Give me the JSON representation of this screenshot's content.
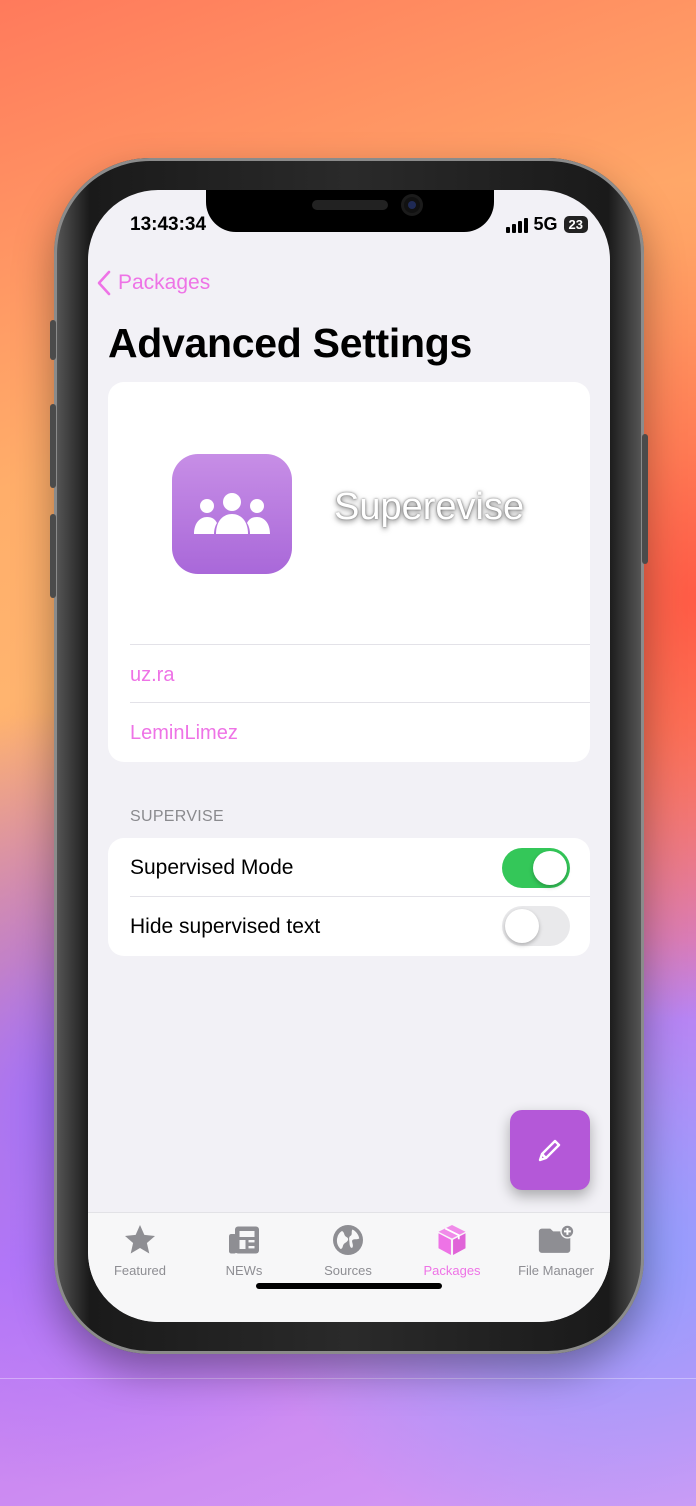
{
  "status_bar": {
    "time": "13:43:34",
    "network": "5G",
    "battery": "23"
  },
  "nav": {
    "back_label": "Packages",
    "title": "Advanced Settings"
  },
  "app_info": {
    "name": "Superevise",
    "links": [
      "uz.ra",
      "LeminLimez"
    ]
  },
  "supervise_section": {
    "header": "SUPERVISE",
    "rows": [
      {
        "label": "Supervised Mode",
        "enabled": true
      },
      {
        "label": "Hide supervised text",
        "enabled": false
      }
    ]
  },
  "tab_bar": {
    "tabs": [
      {
        "label": "Featured",
        "icon": "star-icon"
      },
      {
        "label": "NEWs",
        "icon": "newspaper-icon"
      },
      {
        "label": "Sources",
        "icon": "globe-icon"
      },
      {
        "label": "Packages",
        "icon": "package-icon",
        "active": true
      },
      {
        "label": "File Manager",
        "icon": "folder-plus-icon"
      }
    ]
  },
  "colors": {
    "accent": "#ee73e6",
    "toggle_on": "#34c759",
    "fab": "#b458d8"
  }
}
